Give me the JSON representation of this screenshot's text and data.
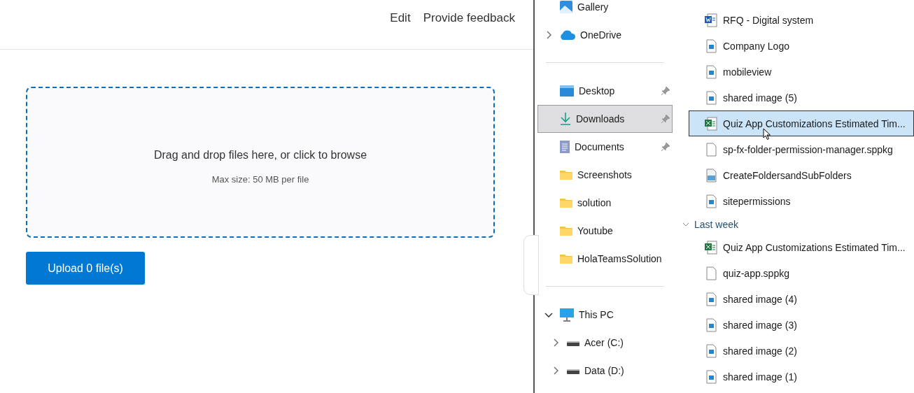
{
  "page": {
    "header_links": [
      "Edit",
      "Provide feedback"
    ],
    "dropzone": {
      "title": "Drag and drop files here, or click to browse",
      "hint": "Max size: 50 MB per file"
    },
    "upload_button": "Upload 0 file(s)"
  },
  "explorer": {
    "nav": [
      {
        "kind": "gallery",
        "label": "Gallery",
        "pinned": false,
        "selected": false
      },
      {
        "kind": "onedrive",
        "label": "OneDrive",
        "expanded": false,
        "pinned": false,
        "selected": false
      },
      {
        "kind": "separator"
      },
      {
        "kind": "desktop",
        "label": "Desktop",
        "pinned": true,
        "selected": false
      },
      {
        "kind": "downloads",
        "label": "Downloads",
        "pinned": true,
        "selected": true
      },
      {
        "kind": "documents",
        "label": "Documents",
        "pinned": true,
        "selected": false
      },
      {
        "kind": "folder",
        "label": "Screenshots",
        "pinned": false,
        "selected": false
      },
      {
        "kind": "folder",
        "label": "solution",
        "pinned": false,
        "selected": false
      },
      {
        "kind": "folder",
        "label": "Youtube",
        "pinned": false,
        "selected": false
      },
      {
        "kind": "folder",
        "label": "HolaTeamsSolution",
        "pinned": false,
        "selected": false
      },
      {
        "kind": "separator"
      },
      {
        "kind": "pc",
        "label": "This PC",
        "expanded": true,
        "pinned": false,
        "selected": false,
        "children": [
          {
            "kind": "drive",
            "label": "Acer (C:)",
            "expanded": false,
            "pinned": false,
            "selected": false
          },
          {
            "kind": "drive",
            "label": "Data (D:)",
            "expanded": false,
            "pinned": false,
            "selected": false
          }
        ]
      }
    ],
    "groups": [
      {
        "files": [
          {
            "kind": "word",
            "name": "RFQ - Digital system",
            "selected": false
          },
          {
            "kind": "image",
            "name": "Company Logo",
            "selected": false
          },
          {
            "kind": "image",
            "name": "mobileview",
            "selected": false
          },
          {
            "kind": "image",
            "name": "shared image (5)",
            "selected": false
          },
          {
            "kind": "excel",
            "name": "Quiz App Customizations Estimated Tim...",
            "selected": true
          },
          {
            "kind": "blank",
            "name": "sp-fx-folder-permission-manager.sppkg",
            "selected": false
          },
          {
            "kind": "app",
            "name": "CreateFoldersandSubFolders",
            "selected": false
          },
          {
            "kind": "image",
            "name": "sitepermissions",
            "selected": false
          }
        ]
      },
      {
        "label": "Last week",
        "expanded": true,
        "files": [
          {
            "kind": "excel",
            "name": "Quiz App Customizations Estimated Tim...",
            "selected": false
          },
          {
            "kind": "blank",
            "name": "quiz-app.sppkg",
            "selected": false
          },
          {
            "kind": "image",
            "name": "shared image (4)",
            "selected": false
          },
          {
            "kind": "image",
            "name": "shared image (3)",
            "selected": false
          },
          {
            "kind": "image",
            "name": "shared image (2)",
            "selected": false
          },
          {
            "kind": "image",
            "name": "shared image (1)",
            "selected": false
          }
        ]
      }
    ]
  }
}
